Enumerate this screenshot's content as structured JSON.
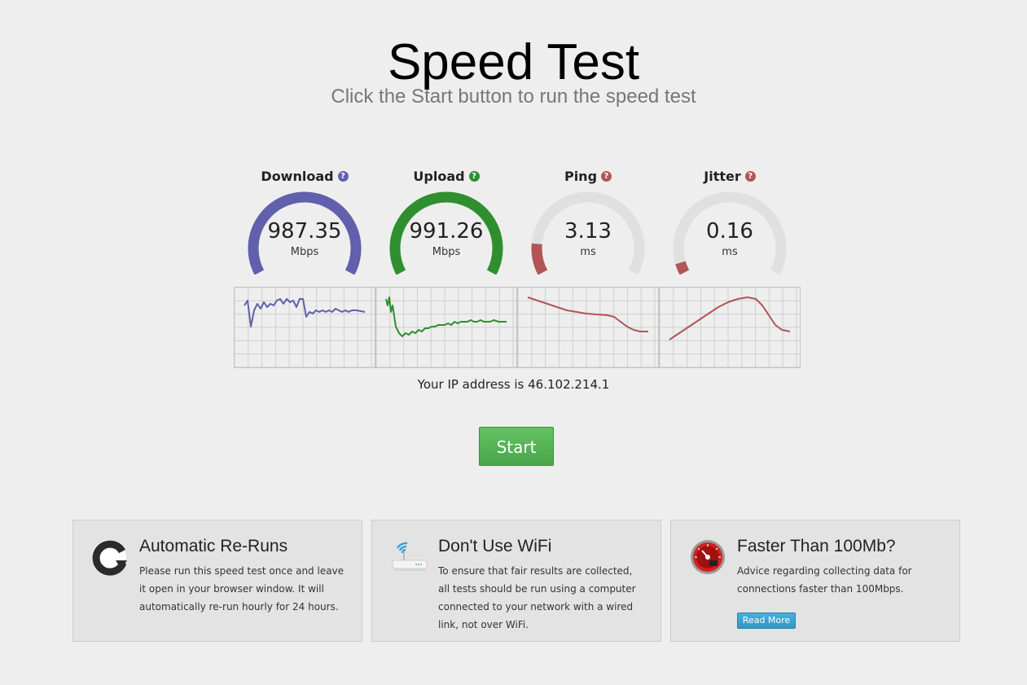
{
  "header": {
    "title": "Speed Test",
    "subtitle": "Click the Start button to run the speed test"
  },
  "meters": [
    {
      "label": "Download",
      "value": "987.35",
      "unit": "Mbps",
      "color": "#6060ad",
      "fill": 1.0,
      "help": "?"
    },
    {
      "label": "Upload",
      "value": "991.26",
      "unit": "Mbps",
      "color": "#2f8f2f",
      "fill": 1.0,
      "help": "?"
    },
    {
      "label": "Ping",
      "value": "3.13",
      "unit": "ms",
      "color": "#b05656",
      "fill": 0.14,
      "help": "?"
    },
    {
      "label": "Jitter",
      "value": "0.16",
      "unit": "ms",
      "color": "#b05656",
      "fill": 0.05,
      "help": "?"
    }
  ],
  "gauge_track_color": "#e0e0e0",
  "ip": {
    "text": "Your IP address is 46.102.214.1"
  },
  "start_button": {
    "label": "Start"
  },
  "cards": [
    {
      "title": "Automatic Re-Runs",
      "text": "Please run this speed test once and leave it open in your browser window. It will automatically re-run hourly for 24 hours.",
      "icon": "refresh-icon"
    },
    {
      "title": "Don't Use WiFi",
      "text": "To ensure that fair results are collected, all tests should be run using a computer connected to your network with a wired link, not over WiFi.",
      "icon": "wifi-router-icon"
    },
    {
      "title": "Faster Than 100Mb?",
      "text": "Advice regarding collecting data for connections faster than 100Mbps.",
      "icon": "speedometer-icon",
      "button": "Read More"
    }
  ]
}
